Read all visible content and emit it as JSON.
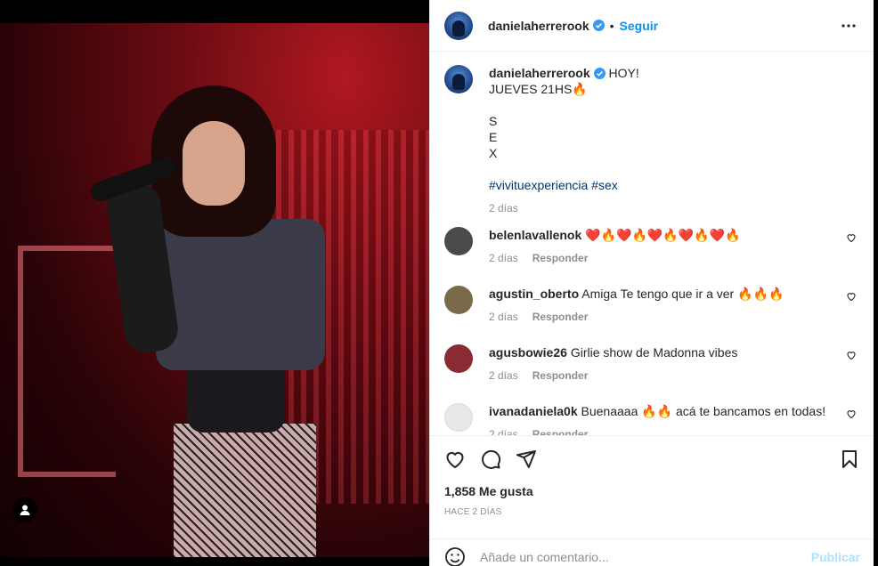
{
  "post": {
    "username": "danielaherrerook",
    "follow_label": "Seguir",
    "separator": "•",
    "caption": {
      "lines": [
        "HOY!",
        "JUEVES 21HS🔥",
        "",
        "S",
        "E",
        "X",
        ""
      ],
      "hashtags": "#vivituexperiencia #sex",
      "time": "2 días"
    },
    "comments": [
      {
        "username": "belenlavallenok",
        "text": "❤️🔥❤️🔥❤️🔥❤️🔥❤️🔥",
        "time": "2 días",
        "reply_label": "Responder",
        "avatar_color": "#4a4a4a"
      },
      {
        "username": "agustin_oberto",
        "text": "Amiga Te tengo que ir a ver 🔥🔥🔥",
        "time": "2 días",
        "reply_label": "Responder",
        "avatar_color": "#7a6a4a"
      },
      {
        "username": "agusbowie26",
        "text": "Girlie show de Madonna vibes",
        "time": "2 días",
        "reply_label": "Responder",
        "avatar_color": "#8a2a32"
      },
      {
        "username": "ivanadaniela0k",
        "text": "Buenaaaa 🔥🔥 acá te bancamos en todas!",
        "time": "2 días",
        "reply_label": "Responder",
        "avatar_color": "#e8e8e8"
      }
    ],
    "likes": "1,858 Me gusta",
    "posted_ago": "HACE 2 DÍAS",
    "comment_placeholder": "Añade un comentario...",
    "publish_label": "Publicar"
  },
  "icons": {
    "more": "more-options-icon",
    "like": "heart-icon",
    "comment": "comment-icon",
    "share": "share-icon",
    "save": "bookmark-icon",
    "emoji": "emoji-icon",
    "verified": "verified-badge-icon",
    "user_tag": "user-tag-icon"
  },
  "colors": {
    "accent": "#0095f6",
    "verified": "#3897f0",
    "hashtag": "#00376b",
    "muted": "#8e8e8e"
  }
}
